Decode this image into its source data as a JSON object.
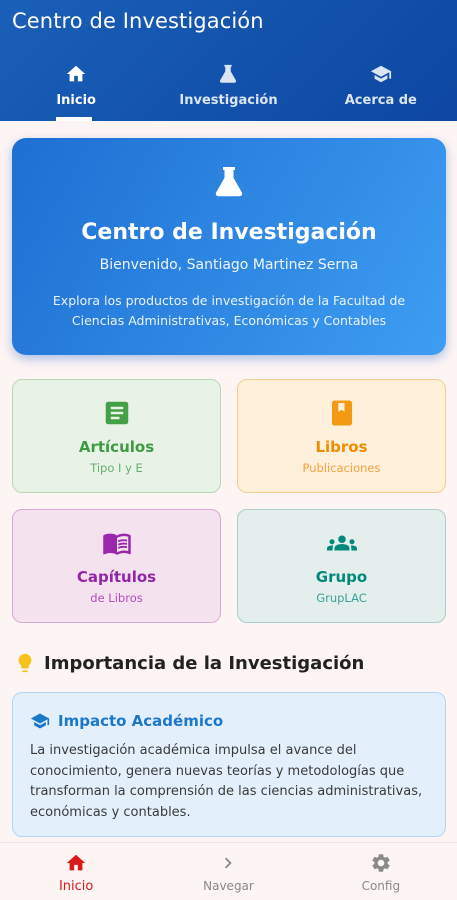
{
  "app": {
    "title": "Centro de Investigación"
  },
  "tabs": [
    {
      "label": "Inicio",
      "icon": "home-icon",
      "active": true
    },
    {
      "label": "Investigación",
      "icon": "flask-icon",
      "active": false
    },
    {
      "label": "Acerca de",
      "icon": "graduation-cap-icon",
      "active": false
    }
  ],
  "hero": {
    "icon": "flask-icon",
    "title": "Centro de Investigación",
    "welcome": "Bienvenido, Santiago Martinez Serna",
    "description": "Explora los productos de investigación de la Facultad de Ciencias Administrativas, Económicas y Contables"
  },
  "categories": [
    {
      "title": "Artículos",
      "subtitle": "Tipo I y E",
      "icon": "article-icon",
      "color": "#43a047"
    },
    {
      "title": "Libros",
      "subtitle": "Publicaciones",
      "icon": "book-icon",
      "color": "#f39a12"
    },
    {
      "title": "Capítulos",
      "subtitle": "de Libros",
      "icon": "open-book-icon",
      "color": "#9b27ad"
    },
    {
      "title": "Grupo",
      "subtitle": "GrupLAC",
      "icon": "group-icon",
      "color": "#00897b"
    }
  ],
  "importance": {
    "icon": "lightbulb-icon",
    "title": "Importancia de la Investigación",
    "card": {
      "icon": "graduation-cap-icon",
      "title": "Impacto Académico",
      "text": "La investigación académica impulsa el avance del conocimiento, genera nuevas teorías y metodologías que transforman la comprensión de las ciencias administrativas, económicas y contables."
    }
  },
  "bottom_nav": [
    {
      "label": "Inicio",
      "icon": "home-icon",
      "active": true
    },
    {
      "label": "Navegar",
      "icon": "chevron-right-icon",
      "active": false
    },
    {
      "label": "Config",
      "icon": "gear-icon",
      "active": false
    }
  ],
  "colors": {
    "primary": "#0d47a1",
    "active_nav": "#d81a1a",
    "accent_bulb": "#f7c21a"
  }
}
